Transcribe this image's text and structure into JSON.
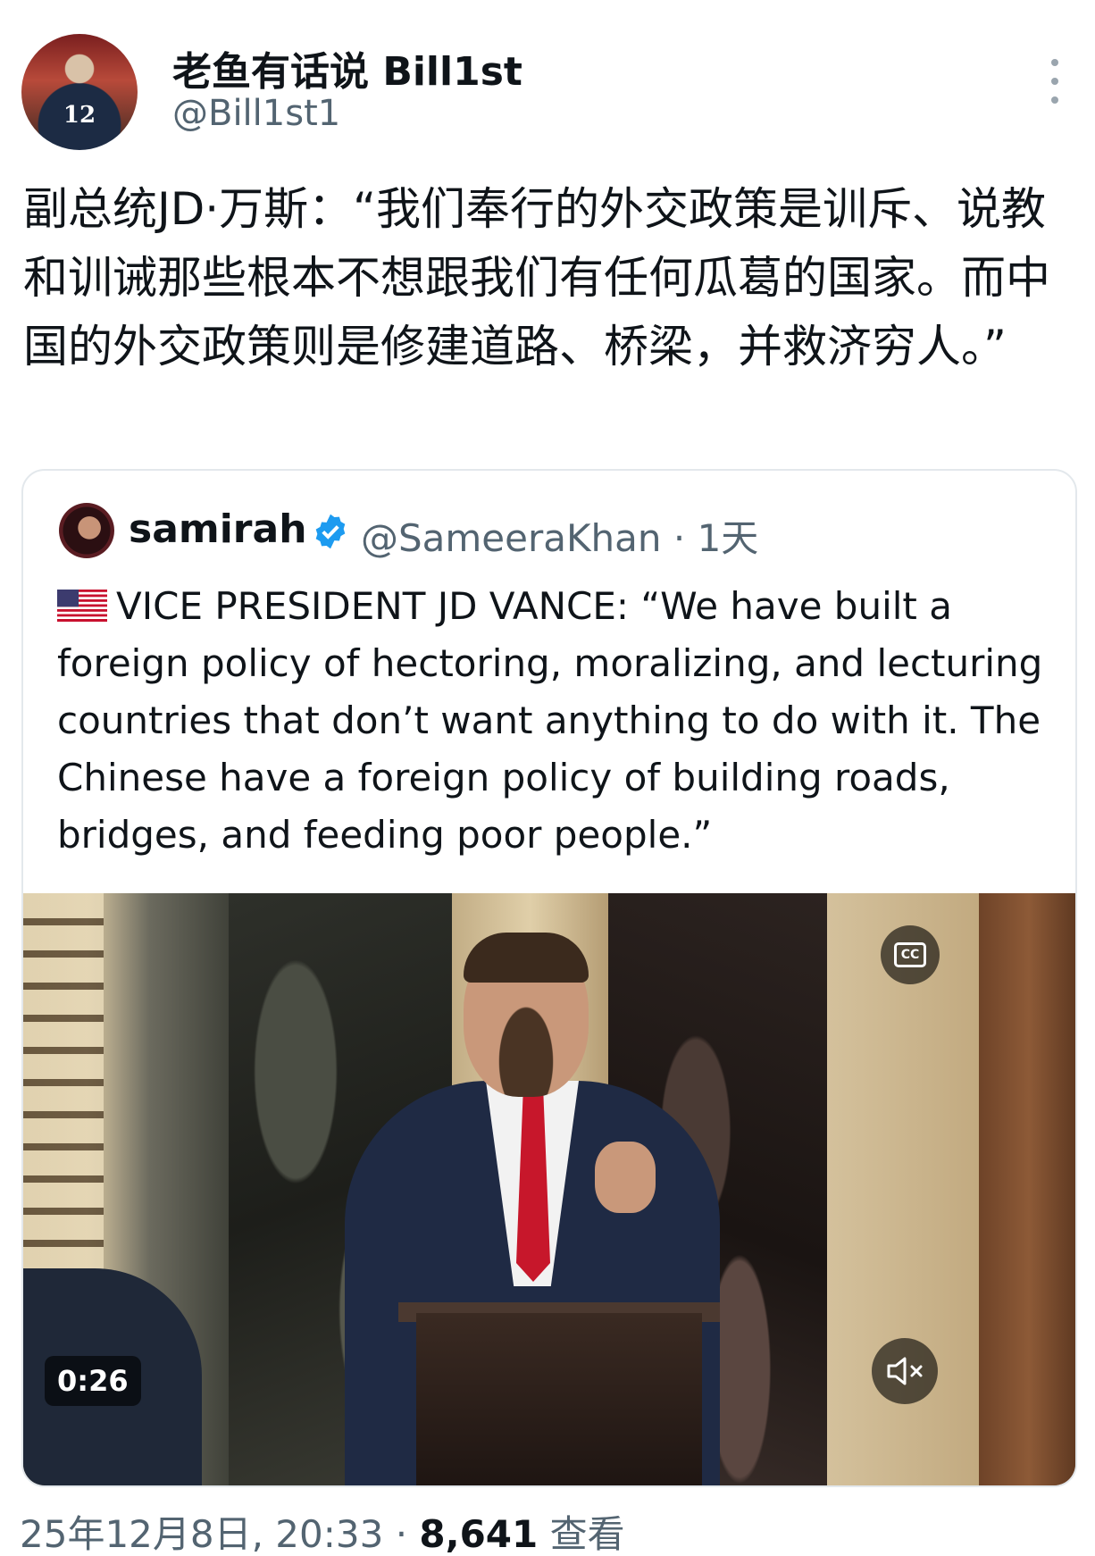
{
  "author": {
    "display_name": "老鱼有话说 Bill1st",
    "handle": "@Bill1st1",
    "avatar_number": "12"
  },
  "tweet": {
    "text": "副总统JD·万斯：“我们奉行的外交政策是训斥、说教和训诫那些根本不想跟我们有任何瓜葛的国家。而中国的外交政策则是修建道路、桥梁，并救济穷人。”"
  },
  "quoted": {
    "name": "samirah",
    "handle_time": "@SameeraKhan · 1天",
    "text": "VICE PRESIDENT JD VANCE: “We have built a foreign policy of hectoring, moralizing, and lecturing countries that don’t want anything to do with it. The Chinese have a foreign policy of building roads, bridges, and feeding poor people.”",
    "verified_color": "#1d9bf0",
    "video": {
      "duration": "0:26",
      "cc_label": "CC"
    }
  },
  "meta": {
    "timestamp": "25年12月8日, 20:33 · ",
    "views_count": "8,641",
    "views_label": " 查看"
  }
}
